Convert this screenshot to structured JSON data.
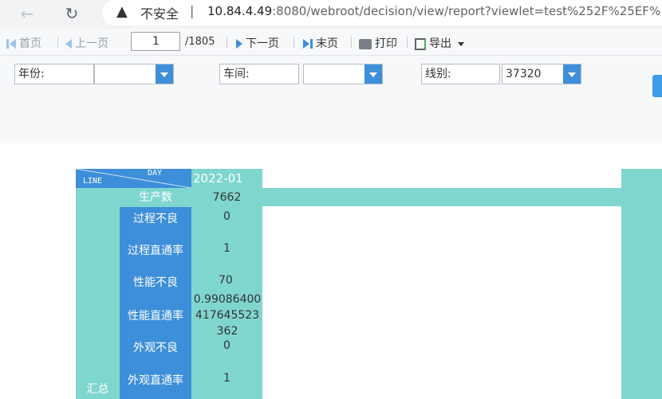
{
  "browser": {
    "back_icon": "←",
    "reload_icon": "↻",
    "warning_icon": "▲",
    "insecure_label": "不安全",
    "url_host": "10.84.4.49",
    "url_rest": ":8080/webroot/decision/view/report?viewlet=test%252F%25EF%"
  },
  "toolbar": {
    "first": "首页",
    "prev": "上一页",
    "page_value": "1",
    "total": "/1805",
    "next": "下一页",
    "last": "末页",
    "print": "打印",
    "export": "导出"
  },
  "params": {
    "year_label": "年份:",
    "year_value": "",
    "workshop_label": "车间:",
    "workshop_value": "",
    "line_label": "线别:",
    "line_value": "37320"
  },
  "report": {
    "header_day": "DAY",
    "header_line": "LINE",
    "month": "2022-01",
    "production_label": "生产数",
    "production_value": "7662",
    "summary_label": "汇总",
    "rows": [
      {
        "label": "过程不良",
        "value": "0"
      },
      {
        "label": "过程直通率",
        "value": "1"
      },
      {
        "label": "性能不良",
        "value": "70"
      },
      {
        "label": "性能直通率",
        "value": "0.99086400417645523362"
      },
      {
        "label": "外观不良",
        "value": "0"
      },
      {
        "label": "外观直通率",
        "value": "1"
      }
    ]
  },
  "colors": {
    "teal": "#7fd6cf",
    "blue": "#3d8fd9"
  }
}
